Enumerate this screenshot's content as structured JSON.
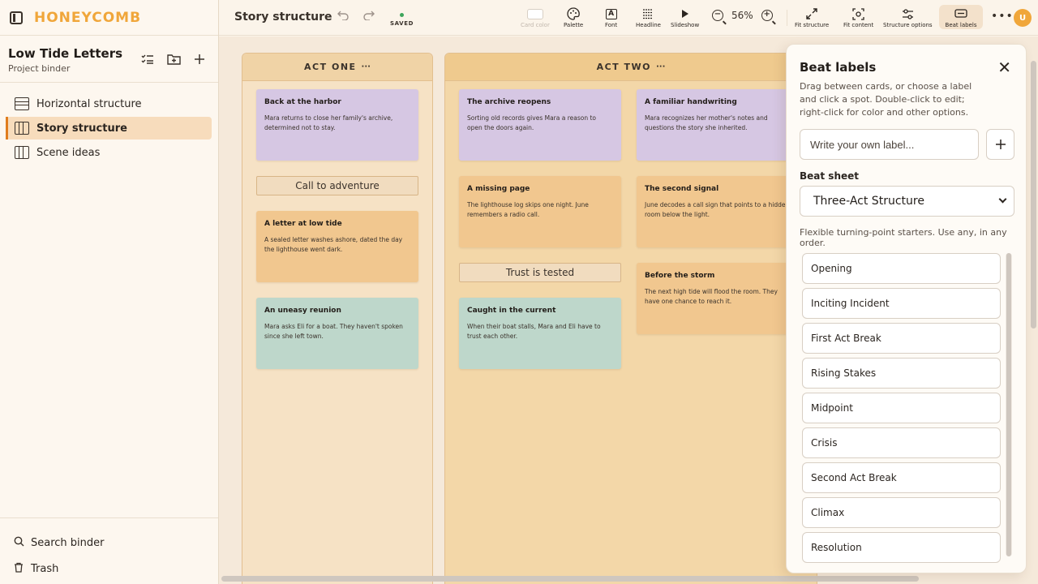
{
  "app": {
    "brand": "HONEYCOMB"
  },
  "project": {
    "title": "Low Tide Letters",
    "subtitle": "Project binder"
  },
  "binder": [
    {
      "label": "Horizontal structure",
      "icon": "rows-icon",
      "active": false
    },
    {
      "label": "Story structure",
      "icon": "columns-icon",
      "active": true
    },
    {
      "label": "Scene ideas",
      "icon": "columns-icon",
      "active": false
    }
  ],
  "sidebar_footer": {
    "search": "Search binder",
    "trash": "Trash"
  },
  "toolbar": {
    "doc_title": "Story structure",
    "saved": "SAVED",
    "card_color": "Card color",
    "palette": "Palette",
    "font": "Font",
    "headline": "Headline",
    "slideshow": "Slideshow",
    "zoom": "56%",
    "fit_structure": "Fit structure",
    "fit_content": "Fit content",
    "structure_options": "Structure options",
    "beat_labels": "Beat labels",
    "avatar": "U"
  },
  "columns": {
    "act_one": "ACT ONE",
    "act_two": "ACT TWO",
    "menu": "···"
  },
  "cards": {
    "harbor": {
      "title": "Back at the harbor",
      "body": "Mara returns to close her family's archive, determined not to stay."
    },
    "letter": {
      "title": "A letter at low tide",
      "body": "A sealed letter washes ashore, dated the day the lighthouse went dark."
    },
    "reunion": {
      "title": "An uneasy reunion",
      "body": "Mara asks Eli for a boat. They haven't spoken since she left town."
    },
    "archive": {
      "title": "The archive reopens",
      "body": "Sorting old records gives Mara a reason to open the doors again."
    },
    "missing": {
      "title": "A missing page",
      "body": "The lighthouse log skips one night. June remembers a radio call."
    },
    "current": {
      "title": "Caught in the current",
      "body": "When their boat stalls, Mara and Eli have to trust each other."
    },
    "handwriting": {
      "title": "A familiar handwriting",
      "body": "Mara recognizes her mother's notes and questions the story she inherited."
    },
    "signal": {
      "title": "The second signal",
      "body": "June decodes a call sign that points to a hidden room below the light."
    },
    "storm": {
      "title": "Before the storm",
      "body": "The next high tide will flood the room. They have one chance to reach it."
    }
  },
  "beats": {
    "call": "Call to adventure",
    "trust": "Trust is tested"
  },
  "panel": {
    "title": "Beat labels",
    "description": "Drag between cards, or choose a label and click a spot. Double-click to edit; right-click for color and other options.",
    "input_placeholder": "Write your own label...",
    "sheet_label": "Beat sheet",
    "sheet_value": "Three-Act Structure",
    "hint": "Flexible turning-point starters. Use any, in any order.",
    "items": [
      "Opening",
      "Inciting Incident",
      "First Act Break",
      "Rising Stakes",
      "Midpoint",
      "Crisis",
      "Second Act Break",
      "Climax",
      "Resolution"
    ]
  }
}
